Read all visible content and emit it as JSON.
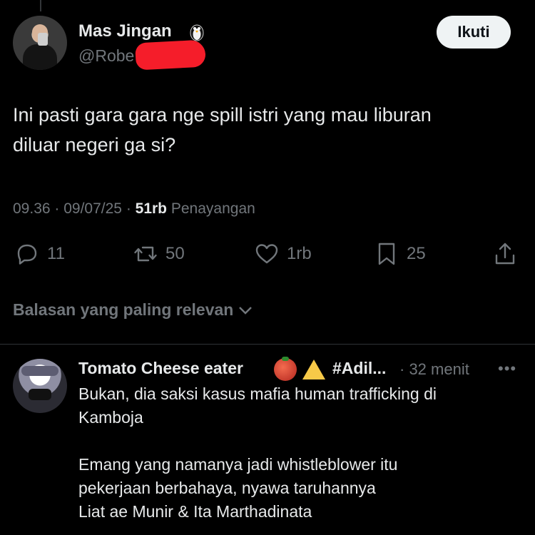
{
  "tweet": {
    "author_name": "Mas Jingan",
    "author_handle": "@Robe",
    "follow_label": "Ikuti",
    "text_line1": "Ini pasti gara gara nge spill istri yang mau liburan",
    "text_line2": "diluar negeri ga si?",
    "time": "09.36",
    "date": "09/07/25",
    "views_count": "51rb",
    "views_label": "Penayangan",
    "replies": "11",
    "retweets": "50",
    "likes": "1rb",
    "bookmarks": "25"
  },
  "sort_label": "Balasan yang paling relevan",
  "reply": {
    "name": "Tomato Cheese eater",
    "hashtag": "#Adil...",
    "time": "· 32 menit",
    "more": "•••",
    "lines": [
      "Bukan, dia saksi kasus mafia human trafficking di",
      "Kamboja",
      "Emang yang namanya jadi whistleblower itu",
      "pekerjaan berbahaya, nyawa taruhannya",
      "Liat ae Munir & Ita Marthadinata"
    ]
  },
  "colors": {
    "background": "#000000",
    "text": "#e7e9ea",
    "muted": "#71767b",
    "redaction": "#f51d2a"
  },
  "icons": [
    "penguin-icon",
    "reply-icon",
    "retweet-icon",
    "heart-icon",
    "bookmark-icon",
    "share-icon",
    "chevron-down-icon",
    "tomato-emoji",
    "cheese-emoji"
  ]
}
